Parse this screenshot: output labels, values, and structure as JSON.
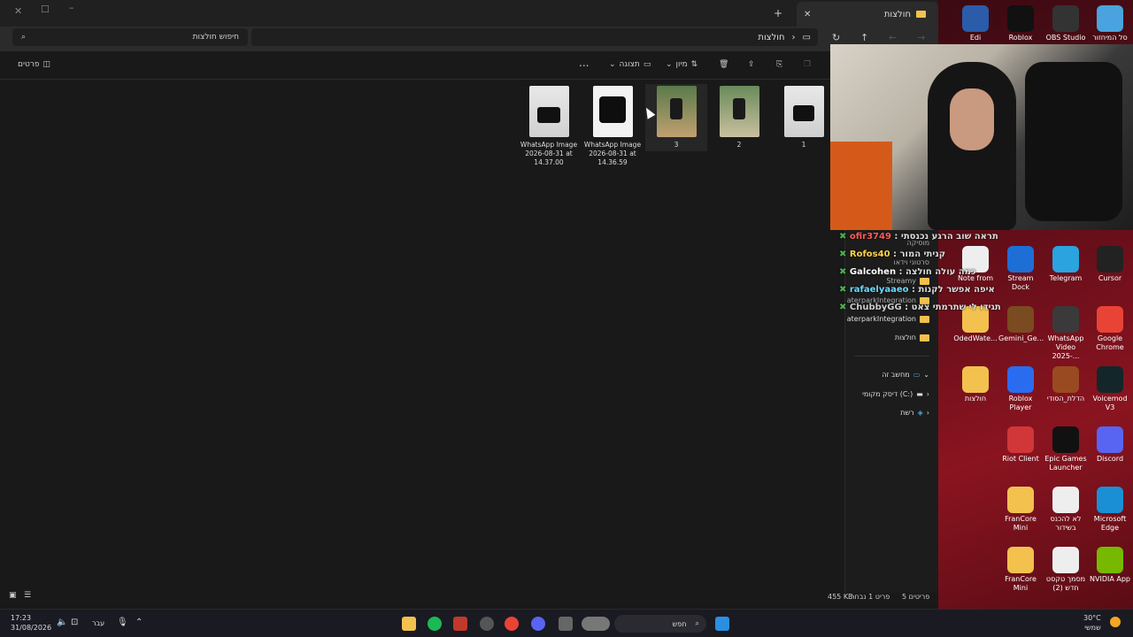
{
  "explorer": {
    "tab_title": "חולצות",
    "search_placeholder": "חיפוש חולצות",
    "path_label": "חולצות",
    "toolbar": {
      "sort_label": "מיון",
      "view_label": "תצוגה",
      "details_label": "פרטים",
      "more_label": "..."
    },
    "files": [
      {
        "name": "1",
        "sub": ""
      },
      {
        "name": "2",
        "sub": ""
      },
      {
        "name": "3",
        "sub": ""
      },
      {
        "name": "WhatsApp Image",
        "sub": "2026-08-31 at",
        "sub2": "14.36.59"
      },
      {
        "name": "WhatsApp Image",
        "sub": "2026-08-31 at",
        "sub2": "14.37.00"
      }
    ],
    "sidebar": {
      "items": [
        "מוסיקה",
        "סרטוני וידאו",
        "Streamy",
        "aterparkIntegration",
        "aterparkIntegration",
        "חולצות"
      ],
      "this_pc": "מחשב זה",
      "local_disk": "דיסק מקומי (C:)",
      "network": "רשת"
    },
    "status": {
      "count": "5 פריטים",
      "selected": "פריט 1 נבחר",
      "size": "455 KB"
    }
  },
  "chat": [
    {
      "user": "ofir3749",
      "msg": "תראה שוב הרגע נכנסתי",
      "color": "#ff5a5a"
    },
    {
      "user": "Rofos40",
      "msg": "קניתי המור",
      "color": "#ffd24a"
    },
    {
      "user": "Galcohen",
      "msg": "כמה עולה חולצה",
      "color": "#ffffff"
    },
    {
      "user": "rafaelyaaeo",
      "msg": "איפה אפשר לקנות",
      "color": "#6ad9ff"
    },
    {
      "user": "ChubbyGG",
      "msg": "תגידו לי שתרמתי צאט",
      "color": "#cccccc"
    }
  ],
  "desktop": {
    "icons": [
      {
        "label": "סל המיחזור",
        "color": "#4aa3df"
      },
      {
        "label": "OBS Studio",
        "color": "#333333"
      },
      {
        "label": "Roblox",
        "color": "#111111"
      },
      {
        "label": "Edi",
        "color": "#2a5caa"
      },
      {
        "label": "Cursor",
        "color": "#222222"
      },
      {
        "label": "Telegram",
        "color": "#2aa3de"
      },
      {
        "label": "Stream Dock",
        "color": "#1d6fd6"
      },
      {
        "label": "Note from",
        "color": "#eeeeee"
      },
      {
        "label": "Google Chrome",
        "color": "#e94335"
      },
      {
        "label": "WhatsApp Video 2025-...",
        "color": "#3a3a3a"
      },
      {
        "label": "Gemini_Ge...",
        "color": "#7a4a20"
      },
      {
        "label": "OdedWate...",
        "color": "#f2c14e"
      },
      {
        "label": "Voicemod V3",
        "color": "#13262a"
      },
      {
        "label": "הדלת_הסודי",
        "color": "#9a4a20"
      },
      {
        "label": "Roblox Player",
        "color": "#2a6cf0"
      },
      {
        "label": "חולצות",
        "color": "#f2c14e"
      },
      {
        "label": "Discord",
        "color": "#5865f2"
      },
      {
        "label": "Epic Games Launcher",
        "color": "#111111"
      },
      {
        "label": "Riot Client",
        "color": "#d13639"
      },
      {
        "label": "Microsoft Edge",
        "color": "#1a8fd6"
      },
      {
        "label": "לא להכנס בשידור",
        "color": "#eeeeee"
      },
      {
        "label": "FranCore Mini",
        "color": "#f2c14e"
      },
      {
        "label": "NVIDIA App",
        "color": "#76b900"
      },
      {
        "label": "מסמך טקסט חדש (2)",
        "color": "#eeeeee"
      },
      {
        "label": "FranCore Mini",
        "color": "#f2c14e"
      }
    ]
  },
  "taskbar": {
    "time": "17:23",
    "date": "31/08/2026",
    "lang": "עבר",
    "search_label": "חפש",
    "weather_temp": "30°C",
    "weather_desc": "שמשי"
  }
}
